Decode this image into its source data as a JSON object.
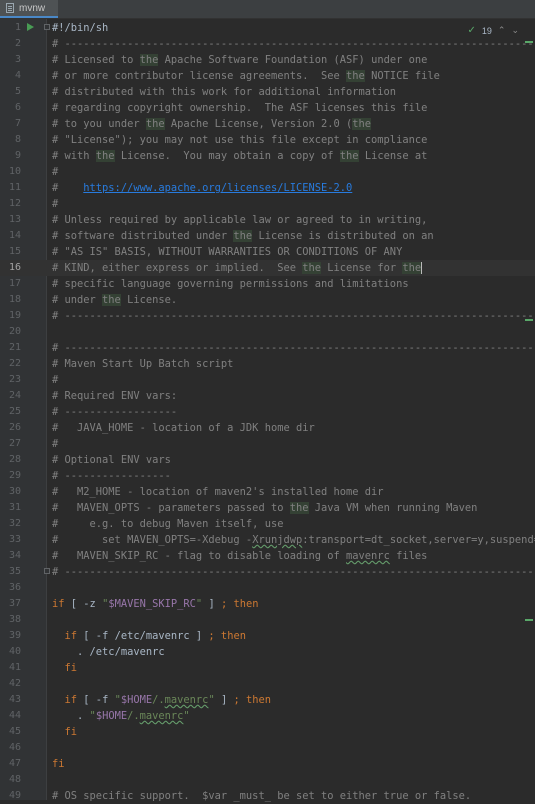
{
  "tab": {
    "label": "mvnw",
    "icon": "file-icon"
  },
  "inspection": {
    "count": "19",
    "check_icon": "checkmark-icon",
    "up_icon": "chevron-up-icon",
    "down_icon": "chevron-down-icon"
  },
  "current_line": 16,
  "lines": [
    {
      "n": "1",
      "h": "<span class=\"plain\">#!/bin/sh</span>"
    },
    {
      "n": "2",
      "h": "# ----------------------------------------------------------------------------"
    },
    {
      "n": "3",
      "h": "# Licensed to <span class=\"hl\">the</span> Apache Software Foundation (ASF) under one"
    },
    {
      "n": "4",
      "h": "# or more contributor license agreements.  See <span class=\"hl\">the</span> NOTICE file"
    },
    {
      "n": "5",
      "h": "# distributed with this work for additional information"
    },
    {
      "n": "6",
      "h": "# regarding copyright ownership.  The ASF licenses this file"
    },
    {
      "n": "7",
      "h": "# to you under <span class=\"hl\">the</span> Apache License, Version 2.0 (<span class=\"hl\">the</span>"
    },
    {
      "n": "8",
      "h": "# \"License\"); you may not use this file except in compliance"
    },
    {
      "n": "9",
      "h": "# with <span class=\"hl\">the</span> License.  You may obtain a copy of <span class=\"hl\">the</span> License at"
    },
    {
      "n": "10",
      "h": "#"
    },
    {
      "n": "11",
      "h": "#    <span class=\"link\">https://www.apache.org/licenses/LICENSE-2.0</span>"
    },
    {
      "n": "12",
      "h": "#"
    },
    {
      "n": "13",
      "h": "# Unless required by applicable law or agreed to in writing,"
    },
    {
      "n": "14",
      "h": "# software distributed under <span class=\"hl\">the</span> License is distributed on an"
    },
    {
      "n": "15",
      "h": "# \"AS IS\" BASIS, WITHOUT WARRANTIES OR CONDITIONS OF ANY"
    },
    {
      "n": "16",
      "h": "# KIND, either express or implied.  See <span class=\"hl\">the</span> License for <span class=\"hl caret\">the</span>"
    },
    {
      "n": "17",
      "h": "# specific language governing permissions and limitations"
    },
    {
      "n": "18",
      "h": "# under <span class=\"hl\">the</span> License."
    },
    {
      "n": "19",
      "h": "# ----------------------------------------------------------------------------"
    },
    {
      "n": "20",
      "h": ""
    },
    {
      "n": "21",
      "h": "# ----------------------------------------------------------------------------"
    },
    {
      "n": "22",
      "h": "# Maven Start Up Batch script"
    },
    {
      "n": "23",
      "h": "#"
    },
    {
      "n": "24",
      "h": "# Required ENV vars:"
    },
    {
      "n": "25",
      "h": "# ------------------"
    },
    {
      "n": "26",
      "h": "#   JAVA_HOME - location of a JDK home dir"
    },
    {
      "n": "27",
      "h": "#"
    },
    {
      "n": "28",
      "h": "# Optional ENV vars"
    },
    {
      "n": "29",
      "h": "# -----------------"
    },
    {
      "n": "30",
      "h": "#   M2_HOME - location of maven2's installed home dir"
    },
    {
      "n": "31",
      "h": "#   MAVEN_OPTS - parameters passed to <span class=\"hl\">the</span> Java VM when running Maven"
    },
    {
      "n": "32",
      "h": "#     e.g. to debug Maven itself, use"
    },
    {
      "n": "33",
      "h": "#       set MAVEN_OPTS=-Xdebug -<span class=\"typo\">Xrunjdwp</span>:transport=dt_socket,server=y,suspend=y"
    },
    {
      "n": "34",
      "h": "#   MAVEN_SKIP_RC - flag to disable loading of <span class=\"typo\">mavenrc</span> files"
    },
    {
      "n": "35",
      "h": "# ----------------------------------------------------------------------------"
    },
    {
      "n": "36",
      "h": ""
    },
    {
      "n": "37",
      "h": "<span class=\"kw\">if</span> <span class=\"plain\">[ -z </span><span class=\"str\">\"</span><span class=\"var\">$MAVEN_SKIP_RC</span><span class=\"str\">\"</span><span class=\"plain\"> ] </span><span class=\"kw\">; then</span>"
    },
    {
      "n": "38",
      "h": ""
    },
    {
      "n": "39",
      "h": "  <span class=\"kw\">if</span> <span class=\"plain\">[ -f /etc/mavenrc ] </span><span class=\"kw\">; then</span>"
    },
    {
      "n": "40",
      "h": "    <span class=\"plain\">. /etc/mavenrc</span>"
    },
    {
      "n": "41",
      "h": "  <span class=\"kw\">fi</span>"
    },
    {
      "n": "42",
      "h": ""
    },
    {
      "n": "43",
      "h": "  <span class=\"kw\">if</span> <span class=\"plain\">[ -f </span><span class=\"str\">\"</span><span class=\"var\">$HOME</span><span class=\"str\">/.<span class=\"typo\">mavenrc</span>\"</span><span class=\"plain\"> ] </span><span class=\"kw\">; then</span>"
    },
    {
      "n": "44",
      "h": "    <span class=\"plain\">. </span><span class=\"str\">\"</span><span class=\"var\">$HOME</span><span class=\"str\">/.<span class=\"typo\">mavenrc</span>\"</span>"
    },
    {
      "n": "45",
      "h": "  <span class=\"kw\">fi</span>"
    },
    {
      "n": "46",
      "h": ""
    },
    {
      "n": "47",
      "h": "<span class=\"kw\">fi</span>"
    },
    {
      "n": "48",
      "h": ""
    },
    {
      "n": "49",
      "h": "# OS specific support.  $var _must_ be set to either true or false."
    }
  ]
}
